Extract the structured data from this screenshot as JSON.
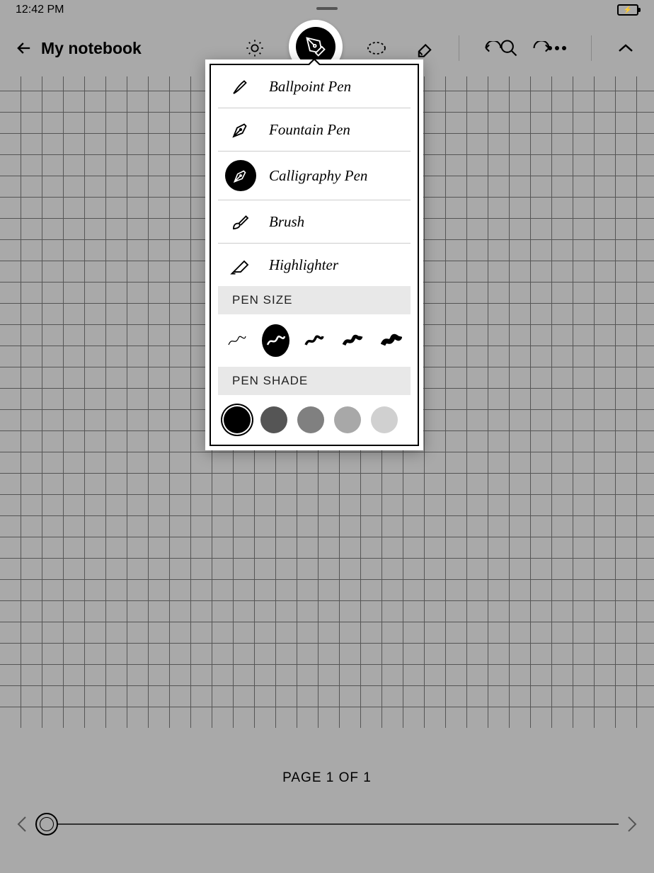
{
  "status": {
    "time": "12:42 PM"
  },
  "header": {
    "title": "My notebook"
  },
  "popup": {
    "pens": [
      {
        "label": "Ballpoint Pen",
        "selected": false
      },
      {
        "label": "Fountain Pen",
        "selected": false
      },
      {
        "label": "Calligraphy Pen",
        "selected": true
      },
      {
        "label": "Brush",
        "selected": false
      },
      {
        "label": "Highlighter",
        "selected": false
      }
    ],
    "sizeLabel": "PEN SIZE",
    "shadeLabel": "PEN SHADE",
    "sizes": [
      {
        "selected": false
      },
      {
        "selected": true
      },
      {
        "selected": false
      },
      {
        "selected": false
      },
      {
        "selected": false
      }
    ],
    "shades": [
      {
        "color": "#000000",
        "selected": true
      },
      {
        "color": "#555555",
        "selected": false
      },
      {
        "color": "#808080",
        "selected": false
      },
      {
        "color": "#a8a8a8",
        "selected": false
      },
      {
        "color": "#d0d0d0",
        "selected": false
      }
    ]
  },
  "footer": {
    "pageLabel": "PAGE 1 OF 1"
  }
}
